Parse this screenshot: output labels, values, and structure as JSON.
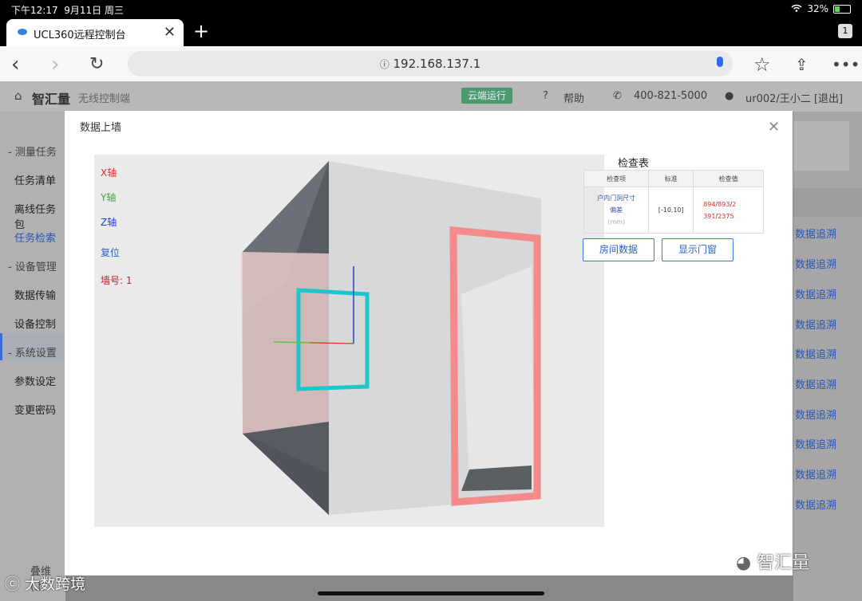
{
  "status_bar": {
    "time": "下午12:17",
    "date": "9月11日 周三",
    "battery": "32%"
  },
  "browser": {
    "tab_title": "UCL360远程控制台",
    "tab_count": "1",
    "url": "192.168.137.1"
  },
  "app_header": {
    "brand": "智汇量",
    "subtitle": "无线控制端",
    "cloud_badge": "云端运行",
    "help": "帮助",
    "phone": "400-821-5000",
    "user": "ur002/王小二 [退出]"
  },
  "sidebar": {
    "group1": "- 测量任务",
    "item_task_list": "任务清单",
    "item_offline": "离线任务包",
    "item_task_search": "任务检索",
    "group2": "- 设备管理",
    "item_data_transfer": "数据传输",
    "item_device_control": "设备控制",
    "group3": "- 系统设置",
    "item_params": "参数设定",
    "item_password": "变更密码",
    "bottom_text": "叠维(上"
  },
  "right_column": {
    "trace_label": "数据追溯"
  },
  "modal": {
    "title": "数据上墙",
    "viewer": {
      "x_axis": "X轴",
      "y_axis": "Y轴",
      "z_axis": "Z轴",
      "reset": "复位",
      "wall_no": "墙号: 1"
    },
    "check_title": "检查表",
    "check_table": {
      "headers": [
        "检查项",
        "标准",
        "检查值"
      ],
      "row": {
        "item_line1": "户内门洞尺寸",
        "item_line2": "偏差",
        "item_unit": "(mm)",
        "standard": "[-10,10]",
        "v1": "894",
        "v2": "893",
        "v3": "2",
        "v4": "391",
        "v5": "2375"
      }
    },
    "btn_room_data": "房间数据",
    "btn_show_door": "显示门窗"
  },
  "watermarks": {
    "left": "大数跨境",
    "right": "智汇量"
  },
  "colors": {
    "accent": "#3a76d6",
    "door_frame": "#f48a8a",
    "window_frame": "#1cc6cc",
    "wall_dark": "#565c62"
  }
}
